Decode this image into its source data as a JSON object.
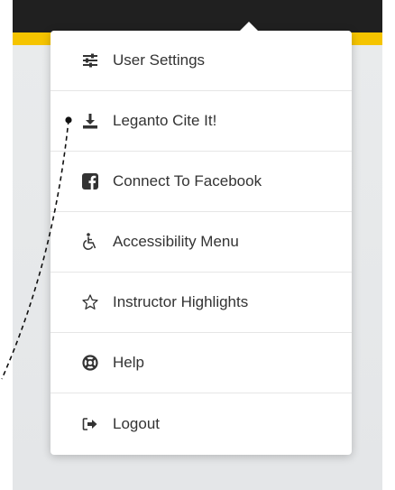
{
  "colors": {
    "topbar": "#202020",
    "accent": "#f5c400",
    "backdrop": "#e7e9ea",
    "menu_bg": "#ffffff",
    "text": "#333333"
  },
  "menu": {
    "items": [
      {
        "label": "User Settings",
        "icon": "sliders-icon"
      },
      {
        "label": "Leganto Cite It!",
        "icon": "download-icon"
      },
      {
        "label": "Connect To Facebook",
        "icon": "facebook-icon"
      },
      {
        "label": "Accessibility Menu",
        "icon": "wheelchair-icon"
      },
      {
        "label": "Instructor Highlights",
        "icon": "star-icon"
      },
      {
        "label": "Help",
        "icon": "lifebuoy-icon"
      },
      {
        "label": "Logout",
        "icon": "logout-icon"
      }
    ]
  }
}
